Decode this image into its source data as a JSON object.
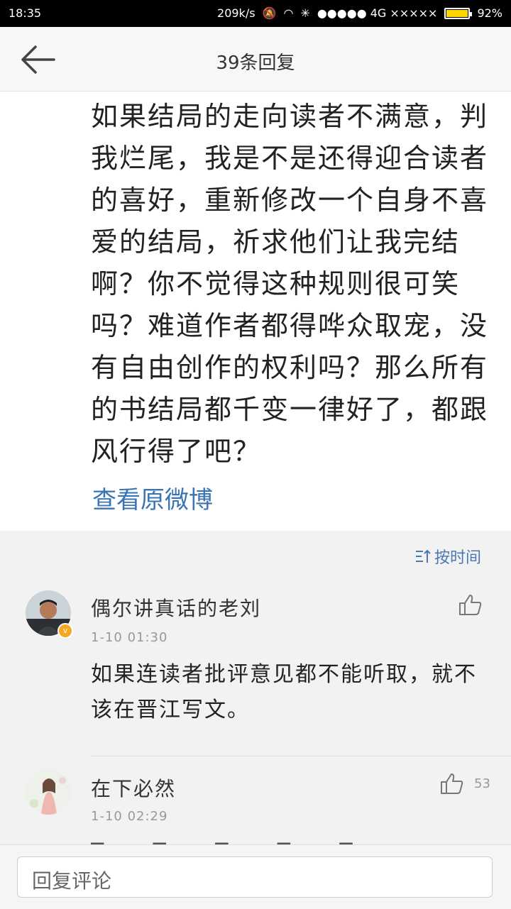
{
  "status": {
    "time": "18:35",
    "speed": "209k/s",
    "network": "4G",
    "signal": "●●●●● 4G ×××××",
    "battery": "92%",
    "battery_level": 0.92
  },
  "header": {
    "title": "39条回复"
  },
  "post": {
    "text": "如果结局的走向读者不满意，判我烂尾，我是不是还得迎合读者的喜好，重新修改一个自身不喜爱的结局，祈求他们让我完结啊？你不觉得这种规则很可笑吗？难道作者都得哗众取宠，没有自由创作的权利吗？那么所有的书结局都千变一律好了，都跟风行得了吧？",
    "view_original": "查看原微博"
  },
  "sort": {
    "label": "按时间"
  },
  "comments": [
    {
      "name": "偶尔讲真话的老刘",
      "time": "1-10 01:30",
      "text": "如果连读者批评意见都不能听取，就不该在晋江写文。",
      "like_count": ""
    },
    {
      "name": "在下必然",
      "time": "1-10 02:29",
      "text": "",
      "like_count": "53"
    }
  ],
  "reply": {
    "placeholder": "回复评论"
  },
  "colors": {
    "link": "#3b74b6",
    "badge": "#f5a623"
  }
}
